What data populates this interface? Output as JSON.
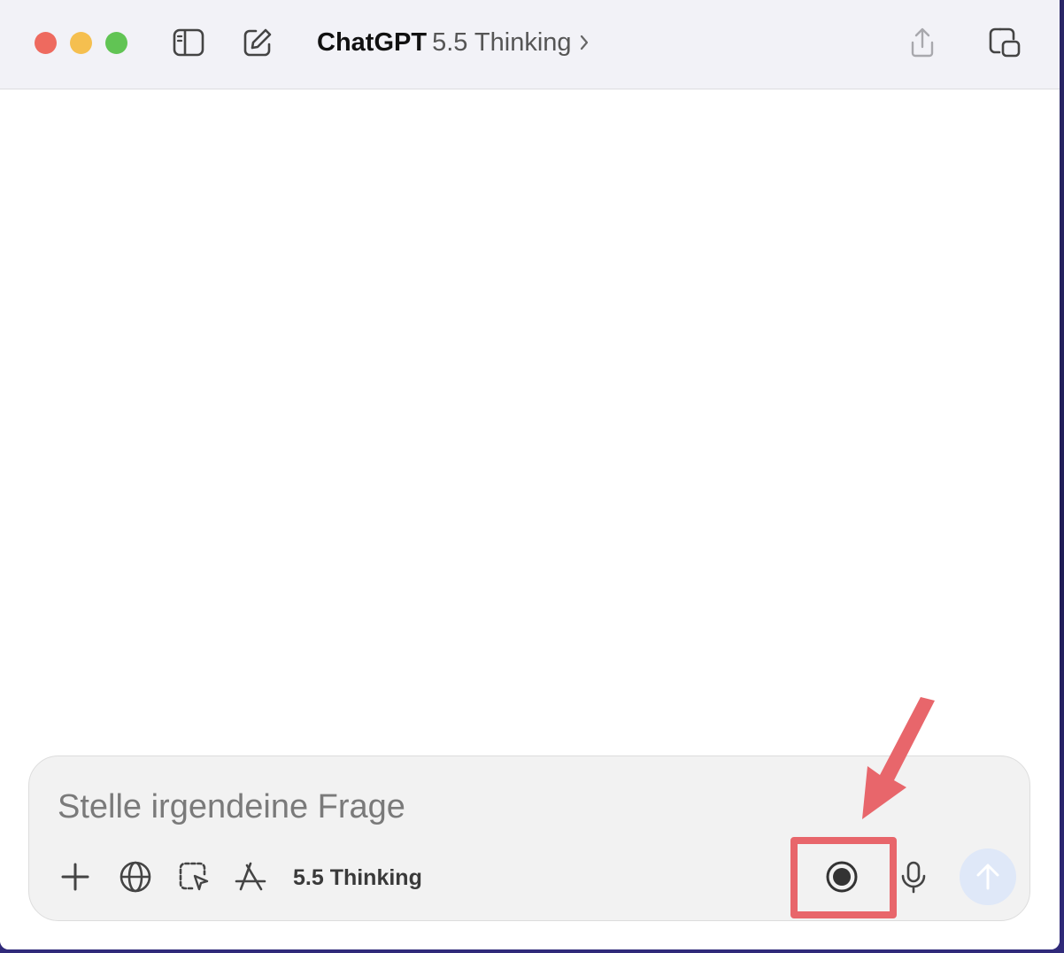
{
  "window": {
    "app_title": "ChatGPT",
    "model_title": "5.5 Thinking"
  },
  "titlebar_icons": {
    "sidebar": "sidebar-toggle-icon",
    "new_chat": "compose-icon",
    "share": "share-icon",
    "popout": "popout-window-icon"
  },
  "composer": {
    "placeholder": "Stelle irgendeine Frage",
    "value": "",
    "model_label": "5.5 Thinking",
    "tools": [
      "plus-icon",
      "globe-icon",
      "screen-select-icon",
      "app-store-icon",
      "record-icon",
      "microphone-icon",
      "send-arrow-icon"
    ]
  },
  "colors": {
    "annotation": "#e8666b",
    "send_disabled": "#dfe8f8",
    "traffic_close": "#ee6a5f",
    "traffic_min": "#f5bf4f",
    "traffic_max": "#61c454"
  }
}
